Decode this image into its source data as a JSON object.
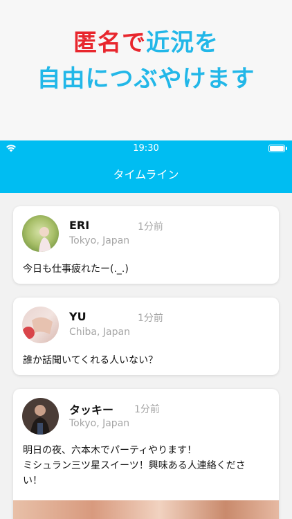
{
  "promo": {
    "line1_part1": "匿名で",
    "line1_part2": "近況を",
    "line2": "自由につぶやけます"
  },
  "status_bar": {
    "time": "19:30"
  },
  "nav": {
    "title": "タイムライン"
  },
  "posts": [
    {
      "name": "ERI",
      "time_ago": "1分前",
      "location": "Tokyo, Japan",
      "message": "今日も仕事疲れたー(._.)"
    },
    {
      "name": "YU",
      "time_ago": "1分前",
      "location": "Chiba, Japan",
      "message": "誰か話聞いてくれる人いない？"
    },
    {
      "name": "タッキー",
      "time_ago": "1分前",
      "location": "Tokyo, Japan",
      "message_line1": "明日の夜、六本木でパーティやります！",
      "message_line2": "ミシュラン三ツ星スイーツ！興味ある人連絡くださ",
      "message_line3": "い！"
    }
  ],
  "colors": {
    "accent": "#00bdf2",
    "promo_red": "#e8262d",
    "promo_blue": "#22b7e8"
  }
}
